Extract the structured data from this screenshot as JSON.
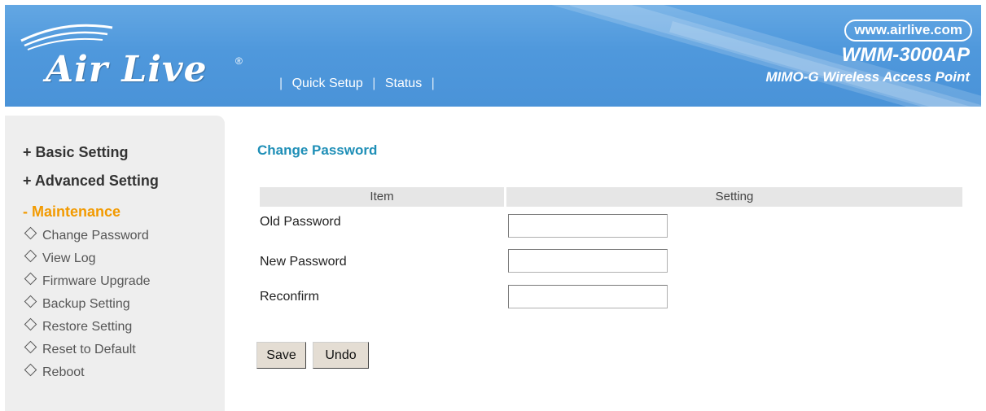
{
  "header": {
    "logo_text": "Air Live",
    "logo_mark": "®",
    "nav": [
      {
        "label": "Quick Setup"
      },
      {
        "label": "Status"
      }
    ],
    "separator": "|",
    "site_url": "www.airlive.com",
    "model": "WMM-3000AP",
    "model_desc": "MIMO-G Wireless Access Point",
    "colors": {
      "banner": "#4f98dc",
      "text": "#ffffff"
    }
  },
  "sidebar": {
    "sections": [
      {
        "label": "+ Basic Setting",
        "expanded": false
      },
      {
        "label": "+ Advanced Setting",
        "expanded": false
      },
      {
        "label": "- Maintenance",
        "expanded": true
      }
    ],
    "items": [
      {
        "label": "Change Password",
        "icon": "diamond-bullet-icon"
      },
      {
        "label": "View Log",
        "icon": "diamond-bullet-icon"
      },
      {
        "label": "Firmware Upgrade",
        "icon": "diamond-bullet-icon"
      },
      {
        "label": "Backup Setting",
        "icon": "diamond-bullet-icon"
      },
      {
        "label": "Restore Setting",
        "icon": "diamond-bullet-icon"
      },
      {
        "label": "Reset to Default",
        "icon": "diamond-bullet-icon"
      },
      {
        "label": "Reboot",
        "icon": "diamond-bullet-icon"
      }
    ],
    "colors": {
      "active_section": "#f29a00",
      "background": "#eeeeee"
    }
  },
  "main": {
    "title": "Change Password",
    "table": {
      "headers": [
        "Item",
        "Setting"
      ],
      "rows": [
        {
          "label": "Old Password",
          "value": ""
        },
        {
          "label": "New Password",
          "value": ""
        },
        {
          "label": "Reconfirm",
          "value": ""
        }
      ]
    },
    "buttons": {
      "save": "Save",
      "undo": "Undo"
    },
    "colors": {
      "title": "#1f8fb7"
    }
  }
}
